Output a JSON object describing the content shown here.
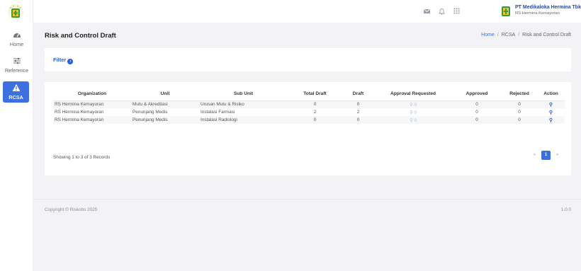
{
  "sidebar": {
    "items": [
      {
        "label": "Home",
        "icon": "dashboard-icon"
      },
      {
        "label": "Reference",
        "icon": "sliders-icon"
      },
      {
        "label": "RCSA",
        "icon": "warning-icon"
      }
    ]
  },
  "topbar": {
    "company_name": "PT Medikaloka Hermina Tbk",
    "company_sub": "RS Hermina Kemayoran"
  },
  "page": {
    "title": "Risk and Control Draft",
    "breadcrumb": [
      "Home",
      "RCSA",
      "Risk and Control Draft"
    ]
  },
  "filter": {
    "label": "Filter"
  },
  "table": {
    "columns": [
      "Organization",
      "Unit",
      "Sub Unit",
      "Total Draft",
      "Draft",
      "Approval Requested",
      "Approved",
      "Rejected",
      "Action"
    ],
    "rows": [
      {
        "organization": "RS Hermina Kemayoran",
        "unit": "Mutu & Akreditasi",
        "sub_unit": "Urusan Mutu & Risiko",
        "total_draft": "0",
        "draft": "0",
        "approval_requested": "0",
        "approved": "0",
        "rejected": "0"
      },
      {
        "organization": "RS Hermina Kemayoran",
        "unit": "Penunjang Medis",
        "sub_unit": "Instalasi Farmasi",
        "total_draft": "2",
        "draft": "2",
        "approval_requested": "0",
        "approved": "0",
        "rejected": "0"
      },
      {
        "organization": "RS Hermina Kemayoran",
        "unit": "Penunjang Medis",
        "sub_unit": "Instalasi Radiologi",
        "total_draft": "0",
        "draft": "0",
        "approval_requested": "0",
        "approved": "0",
        "rejected": "0"
      }
    ],
    "info": "Showing 1 to 3 of 3 Records",
    "pagination": {
      "prev": "«",
      "current": "1",
      "next": "»"
    }
  },
  "footer": {
    "copyright": "Copyright © Riskobs 2025",
    "version": "1.0.0"
  },
  "colors": {
    "accent": "#3d6fe0",
    "link": "#2b5fd8"
  }
}
